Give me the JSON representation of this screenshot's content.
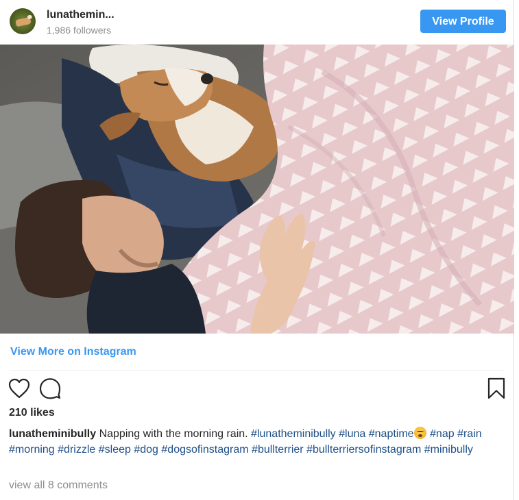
{
  "header": {
    "username": "lunathemin...",
    "followers": "1,986 followers",
    "view_profile_label": "View Profile",
    "avatar_icon": "dog-avatar-icon"
  },
  "photo": {
    "subject": "photo"
  },
  "links": {
    "view_more": "View More on Instagram"
  },
  "actions": {
    "like_icon": "heart-icon",
    "comment_icon": "comment-icon",
    "save_icon": "bookmark-icon"
  },
  "likes": "210 likes",
  "caption": {
    "username": "lunatheminibully",
    "text": "Napping with the morning rain.",
    "tags_before_emoji": [
      "#lunatheminibully",
      "#luna",
      "#naptime"
    ],
    "emoji": "sleeping-face-emoji",
    "tags_after_emoji": [
      "#nap",
      "#rain",
      "#morning",
      "#drizzle",
      "#sleep",
      "#dog",
      "#dogsofinstagram",
      "#bullterrier",
      "#bullterriersofinstagram",
      "#minibully"
    ]
  },
  "comments": "view all 8 comments",
  "colors": {
    "accent": "#3897f0",
    "hashtag": "#1e4f86",
    "secondary_text": "#8e8e8e",
    "primary_text": "#262626"
  }
}
